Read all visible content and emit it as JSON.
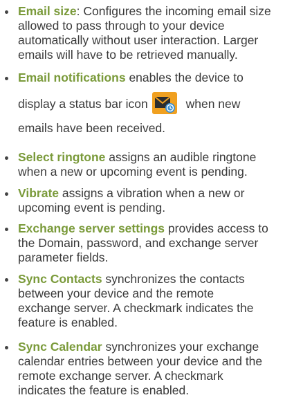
{
  "items": [
    {
      "term": "Email size",
      "sep": ":",
      "lines": [
        " Configures the incoming email size",
        "allowed to pass through to your device",
        "automatically without user interaction. Larger",
        "emails will have to be retrieved manually."
      ]
    },
    {
      "term": "Email notifications",
      "lines": [
        " enables the device to",
        "display a status bar icon",
        " when new",
        "emails have been received."
      ],
      "icon": "new-email-notification-icon",
      "icon_colors": {
        "background": "#f0a020",
        "envelope": "#2d2d2d",
        "badge": "#3a8fd0"
      }
    },
    {
      "term": "Select ringtone",
      "lines": [
        " assigns an audible ringtone",
        "when a new or upcoming event is pending."
      ]
    },
    {
      "term": "Vibrate",
      "lines": [
        " assigns a vibration when a new or",
        "upcoming event is pending."
      ]
    },
    {
      "term": "Exchange server settings",
      "lines": [
        " provides access to",
        "the Domain, password, and exchange server",
        "parameter fields."
      ]
    },
    {
      "term": "Sync Contacts",
      "lines": [
        " synchronizes the contacts",
        "between your device and the remote",
        "exchange server. A checkmark indicates the",
        "feature is enabled."
      ]
    },
    {
      "term": "Sync Calendar",
      "lines": [
        " synchronizes your exchange",
        "calendar entries between your device and the",
        "remote exchange server. A checkmark",
        "indicates the feature is enabled."
      ]
    }
  ],
  "colors": {
    "term": "#7a9a3a",
    "text": "#3a3a3a"
  }
}
